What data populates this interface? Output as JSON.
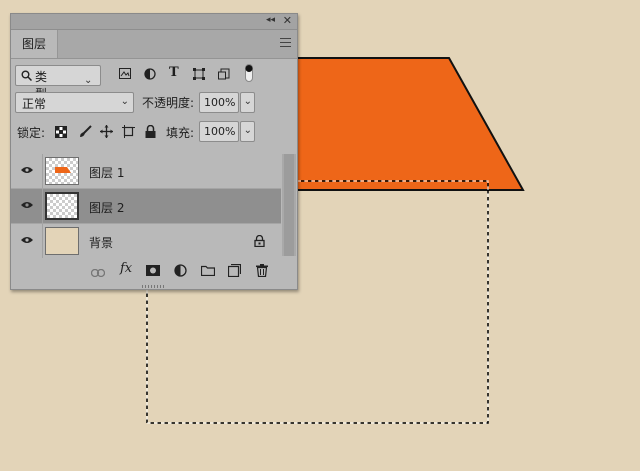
{
  "canvas": {
    "background_color": "#e3d4b8",
    "shape_color": "#ee6618"
  },
  "panel": {
    "tab_label": "图层",
    "filter": {
      "label": "类型"
    },
    "blend_mode": "正常",
    "opacity_label": "不透明度:",
    "opacity_value": "100%",
    "lock_label": "锁定:",
    "fill_label": "填充:",
    "fill_value": "100%",
    "layers": [
      {
        "name": "图层 1"
      },
      {
        "name": "图层 2"
      },
      {
        "name": "背景"
      }
    ],
    "bottom_icons": [
      "link-icon",
      "fx-icon",
      "mask-icon",
      "adjustment-icon",
      "folder-icon",
      "new-layer-icon",
      "trash-icon"
    ],
    "fx_label": "fx"
  }
}
